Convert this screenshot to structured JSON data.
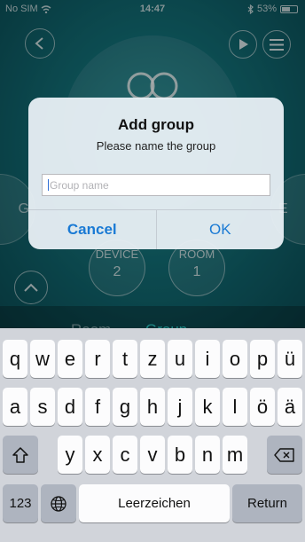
{
  "status_bar": {
    "carrier": "No SIM",
    "time": "14:47",
    "battery": "53%"
  },
  "background_app": {
    "left_side_letter": "G",
    "right_side_letter": "E",
    "device_label": "DEVICE",
    "device_count": "2",
    "room_label": "ROOM",
    "room_count": "1",
    "tabs": [
      "Room",
      "Group"
    ],
    "colors": {
      "background": "#137078",
      "active_tab": "#2ec7c4"
    }
  },
  "dialog": {
    "title": "Add group",
    "message": "Please name the group",
    "input": {
      "value": "",
      "placeholder": "Group name"
    },
    "cancel_label": "Cancel",
    "ok_label": "OK",
    "colors": {
      "button_text": "#1a7ad4"
    }
  },
  "keyboard": {
    "row1": [
      "q",
      "w",
      "e",
      "r",
      "t",
      "z",
      "u",
      "i",
      "o",
      "p",
      "ü"
    ],
    "row2": [
      "a",
      "s",
      "d",
      "f",
      "g",
      "h",
      "j",
      "k",
      "l",
      "ö",
      "ä"
    ],
    "row3": [
      "y",
      "x",
      "c",
      "v",
      "b",
      "n",
      "m"
    ],
    "numbers_label": "123",
    "space_label": "Leerzeichen",
    "return_label": "Return",
    "icons": {
      "shift": "shift-icon",
      "delete": "backspace-icon",
      "globe": "globe-icon"
    }
  }
}
